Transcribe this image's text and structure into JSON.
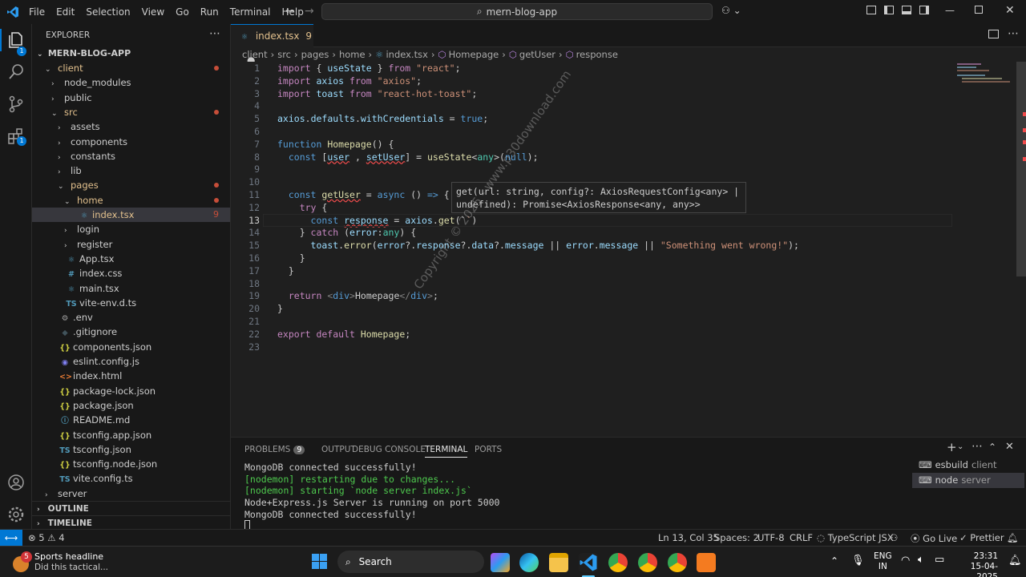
{
  "titlebar": {
    "menu": [
      "File",
      "Edit",
      "Selection",
      "View",
      "Go",
      "Run",
      "Terminal",
      "Help"
    ],
    "search": "mern-blog-app"
  },
  "activity": {
    "explorer_badge": "1",
    "extensions_badge": "1"
  },
  "explorer": {
    "header": "EXPLORER",
    "project": "MERN-BLOG-APP",
    "rows": [
      {
        "label": "client",
        "chev": "⌄",
        "indent": 1,
        "type": "folder",
        "dot": true,
        "color": "#e2c08d"
      },
      {
        "label": "node_modules",
        "chev": "›",
        "indent": 2,
        "type": "folder"
      },
      {
        "label": "public",
        "chev": "›",
        "indent": 2,
        "type": "folder"
      },
      {
        "label": "src",
        "chev": "⌄",
        "indent": 2,
        "type": "folder",
        "dot": true,
        "color": "#e2c08d"
      },
      {
        "label": "assets",
        "chev": "›",
        "indent": 3,
        "type": "folder"
      },
      {
        "label": "components",
        "chev": "›",
        "indent": 3,
        "type": "folder"
      },
      {
        "label": "constants",
        "chev": "›",
        "indent": 3,
        "type": "folder"
      },
      {
        "label": "lib",
        "chev": "›",
        "indent": 3,
        "type": "folder"
      },
      {
        "label": "pages",
        "chev": "⌄",
        "indent": 3,
        "type": "folder",
        "dot": true,
        "color": "#e2c08d"
      },
      {
        "label": "home",
        "chev": "⌄",
        "indent": 4,
        "type": "folder",
        "dot": true,
        "color": "#e2c08d"
      },
      {
        "label": "index.tsx",
        "indent": 5,
        "type": "tsx",
        "count": "9",
        "color": "#e2c08d",
        "selected": true
      },
      {
        "label": "login",
        "chev": "›",
        "indent": 4,
        "type": "folder"
      },
      {
        "label": "register",
        "chev": "›",
        "indent": 4,
        "type": "folder"
      },
      {
        "label": "App.tsx",
        "indent": 3,
        "type": "tsx"
      },
      {
        "label": "index.css",
        "indent": 3,
        "type": "css"
      },
      {
        "label": "main.tsx",
        "indent": 3,
        "type": "tsx"
      },
      {
        "label": "vite-env.d.ts",
        "indent": 3,
        "type": "ts"
      },
      {
        "label": ".env",
        "indent": 2,
        "type": "env"
      },
      {
        "label": ".gitignore",
        "indent": 2,
        "type": "git"
      },
      {
        "label": "components.json",
        "indent": 2,
        "type": "json"
      },
      {
        "label": "eslint.config.js",
        "indent": 2,
        "type": "eslint"
      },
      {
        "label": "index.html",
        "indent": 2,
        "type": "html"
      },
      {
        "label": "package-lock.json",
        "indent": 2,
        "type": "json"
      },
      {
        "label": "package.json",
        "indent": 2,
        "type": "json"
      },
      {
        "label": "README.md",
        "indent": 2,
        "type": "md"
      },
      {
        "label": "tsconfig.app.json",
        "indent": 2,
        "type": "json"
      },
      {
        "label": "tsconfig.json",
        "indent": 2,
        "type": "tsjson"
      },
      {
        "label": "tsconfig.node.json",
        "indent": 2,
        "type": "json"
      },
      {
        "label": "vite.config.ts",
        "indent": 2,
        "type": "ts"
      },
      {
        "label": "server",
        "chev": "›",
        "indent": 1,
        "type": "folder"
      }
    ],
    "outline": "OUTLINE",
    "timeline": "TIMELINE"
  },
  "tab": {
    "label": "index.tsx",
    "count": "9"
  },
  "breadcrumb": [
    "client",
    "src",
    "pages",
    "home",
    "index.tsx",
    "Homepage",
    "getUser",
    "response"
  ],
  "code_lines": [
    [
      [
        "kc",
        "import "
      ],
      [
        "pu",
        "{ "
      ],
      [
        "var",
        "useState"
      ],
      [
        "pu",
        " } "
      ],
      [
        "kc",
        "from "
      ],
      [
        "str",
        "\"react\""
      ],
      [
        "pu",
        ";"
      ]
    ],
    [
      [
        "kc",
        "import "
      ],
      [
        "var",
        "axios "
      ],
      [
        "kc",
        "from "
      ],
      [
        "str",
        "\"axios\""
      ],
      [
        "pu",
        ";"
      ]
    ],
    [
      [
        "kc",
        "import "
      ],
      [
        "var",
        "toast "
      ],
      [
        "kc",
        "from "
      ],
      [
        "str",
        "\"react-hot-toast\""
      ],
      [
        "pu",
        ";"
      ]
    ],
    [],
    [
      [
        "var",
        "axios"
      ],
      [
        "pu",
        "."
      ],
      [
        "var",
        "defaults"
      ],
      [
        "pu",
        "."
      ],
      [
        "var",
        "withCredentials"
      ],
      [
        "pu",
        " = "
      ],
      [
        "kw",
        "true"
      ],
      [
        "pu",
        ";"
      ]
    ],
    [],
    [
      [
        "kw",
        "function "
      ],
      [
        "fn",
        "Homepage"
      ],
      [
        "pu",
        "() {"
      ]
    ],
    [
      [
        "pu",
        "  "
      ],
      [
        "kw",
        "const "
      ],
      [
        "pu",
        "["
      ],
      [
        "varsq",
        "user"
      ],
      [
        "pu",
        " , "
      ],
      [
        "varsq",
        "setUser"
      ],
      [
        "pu",
        "] = "
      ],
      [
        "fn",
        "useState"
      ],
      [
        "pu",
        "<"
      ],
      [
        "ty",
        "any"
      ],
      [
        "pu",
        ">("
      ],
      [
        "kw",
        "null"
      ],
      [
        "pu",
        ");"
      ]
    ],
    [],
    [],
    [
      [
        "pu",
        "  "
      ],
      [
        "kw",
        "const "
      ],
      [
        "fnsq",
        "getUser"
      ],
      [
        "pu",
        " = "
      ],
      [
        "kw",
        "async "
      ],
      [
        "pu",
        "() "
      ],
      [
        "kw",
        "=> "
      ],
      [
        "pu",
        "{"
      ]
    ],
    [
      [
        "pu",
        "    "
      ],
      [
        "kc",
        "try "
      ],
      [
        "pu",
        "{"
      ]
    ],
    [
      [
        "pu",
        "      "
      ],
      [
        "kw",
        "const "
      ],
      [
        "varsq",
        "response"
      ],
      [
        "pu",
        " = "
      ],
      [
        "var",
        "axios"
      ],
      [
        "pu",
        "."
      ],
      [
        "fn",
        "get"
      ],
      [
        "pu",
        "(`"
      ],
      [
        "str",
        "`"
      ],
      [
        "pu",
        ")"
      ]
    ],
    [
      [
        "pu",
        "    } "
      ],
      [
        "kc",
        "catch "
      ],
      [
        "pu",
        "("
      ],
      [
        "var",
        "error"
      ],
      [
        "pu",
        ":"
      ],
      [
        "ty",
        "any"
      ],
      [
        "pu",
        ") {"
      ]
    ],
    [
      [
        "pu",
        "      "
      ],
      [
        "var",
        "toast"
      ],
      [
        "pu",
        "."
      ],
      [
        "fn",
        "error"
      ],
      [
        "pu",
        "("
      ],
      [
        "var",
        "error"
      ],
      [
        "pu",
        "?."
      ],
      [
        "var",
        "response"
      ],
      [
        "pu",
        "?."
      ],
      [
        "var",
        "data"
      ],
      [
        "pu",
        "?."
      ],
      [
        "var",
        "message"
      ],
      [
        "pu",
        " || "
      ],
      [
        "var",
        "error"
      ],
      [
        "pu",
        "."
      ],
      [
        "var",
        "message"
      ],
      [
        "pu",
        " || "
      ],
      [
        "str",
        "\"Something went wrong!\""
      ],
      [
        "pu",
        ");"
      ]
    ],
    [
      [
        "pu",
        "    }"
      ]
    ],
    [
      [
        "pu",
        "  }"
      ]
    ],
    [],
    [
      [
        "pu",
        "  "
      ],
      [
        "kc",
        "return "
      ],
      [
        "tag",
        "<"
      ],
      [
        "kw",
        "div"
      ],
      [
        "tag",
        ">"
      ],
      [
        "pu",
        "Homepage"
      ],
      [
        "tag",
        "</"
      ],
      [
        "kw",
        "div"
      ],
      [
        "tag",
        ">"
      ],
      [
        "pu",
        ";"
      ]
    ],
    [
      [
        "pu",
        "}"
      ]
    ],
    [],
    [
      [
        "kc",
        "export default "
      ],
      [
        "fn",
        "Homepage"
      ],
      [
        "pu",
        ";"
      ]
    ],
    []
  ],
  "current_line": 13,
  "hover": {
    "line1": "get(url: string, config?: AxiosRequestConfig<any> |",
    "line2": "undefined): Promise<AxiosResponse<any, any>>"
  },
  "watermark": "Copyright © 2025 - www.p30download.com",
  "panel": {
    "tabs": [
      {
        "label": "PROBLEMS",
        "badge": "9"
      },
      {
        "label": "OUTPUT"
      },
      {
        "label": "DEBUG CONSOLE"
      },
      {
        "label": "TERMINAL",
        "active": true
      },
      {
        "label": "PORTS"
      }
    ],
    "terminal_lines": [
      {
        "text": "MongoDB connected successfully!",
        "color": "#cccccc"
      },
      {
        "text": "[nodemon] restarting due to changes...",
        "color": "#4ec94e"
      },
      {
        "text": "[nodemon] starting `node server index.js`",
        "color": "#4ec94e"
      },
      {
        "text": "Node+Express.js Server is running on port 5000",
        "color": "#cccccc"
      },
      {
        "text": "MongoDB connected successfully!",
        "color": "#cccccc"
      }
    ],
    "terminals": [
      {
        "name": "esbuild",
        "sub": "client"
      },
      {
        "name": "node",
        "sub": "server"
      }
    ]
  },
  "status": {
    "errors": "5",
    "warnings": "4",
    "position": "Ln 13, Col 35",
    "spaces": "Spaces: 2",
    "encoding": "UTF-8",
    "eol": "CRLF",
    "language": "TypeScript JSX",
    "golive": "Go Live",
    "prettier": "Prettier"
  },
  "taskbar": {
    "news_title": "Sports headline",
    "news_sub": "Did this tactical...",
    "search": "Search",
    "lang1": "ENG",
    "lang2": "IN",
    "time": "23:31",
    "date": "15-04-2025",
    "notif_badge": "5"
  }
}
